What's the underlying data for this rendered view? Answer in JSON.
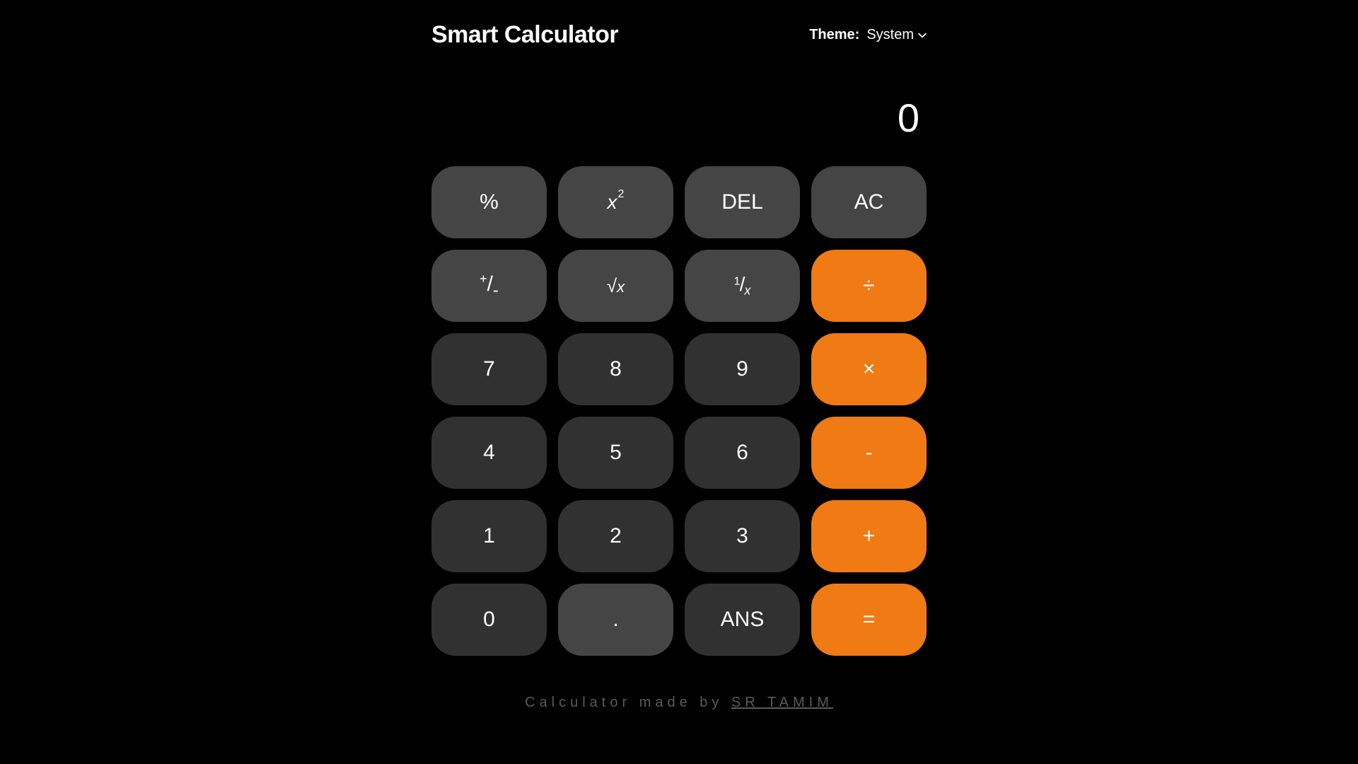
{
  "header": {
    "title": "Smart Calculator",
    "theme_label": "Theme:",
    "theme_selected": "System"
  },
  "display": {
    "value": "0"
  },
  "buttons": {
    "percent": "%",
    "square_x": "x",
    "square_exp": "2",
    "del": "DEL",
    "ac": "AC",
    "pm_plus": "+",
    "pm_slash": "/",
    "pm_minus": "-",
    "sqrt_sym": "√",
    "sqrt_x": "x",
    "recip_one": "1",
    "recip_slash": "/",
    "recip_x": "x",
    "divide": "÷",
    "seven": "7",
    "eight": "8",
    "nine": "9",
    "multiply": "×",
    "four": "4",
    "five": "5",
    "six": "6",
    "minus": "-",
    "one": "1",
    "two": "2",
    "three": "3",
    "plus": "+",
    "zero": "0",
    "dot": ".",
    "ans": "ANS",
    "equals": "="
  },
  "footer": {
    "prefix": "Calculator made by ",
    "author": "SR TAMIM"
  }
}
